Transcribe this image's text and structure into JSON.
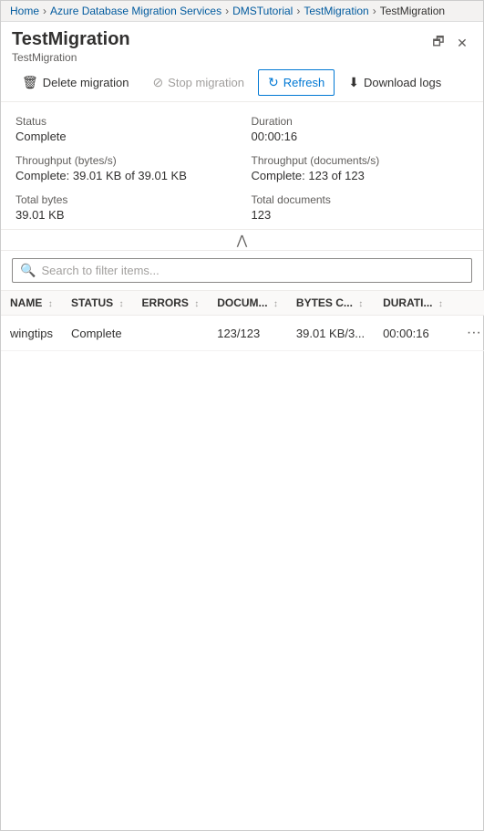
{
  "breadcrumb": {
    "items": [
      {
        "label": "Home",
        "active": true
      },
      {
        "label": "Azure Database Migration Services",
        "active": true
      },
      {
        "label": "DMSTutorial",
        "active": true
      },
      {
        "label": "TestMigration",
        "active": true
      },
      {
        "label": "TestMigration",
        "active": false
      }
    ],
    "separator": "›"
  },
  "header": {
    "title": "TestMigration",
    "subtitle": "TestMigration",
    "window_restore": "🗗",
    "window_close": "✕"
  },
  "toolbar": {
    "delete_label": "Delete migration",
    "stop_label": "Stop migration",
    "refresh_label": "Refresh",
    "download_label": "Download logs"
  },
  "stats": [
    {
      "label": "Status",
      "value": "Complete"
    },
    {
      "label": "Duration",
      "value": "00:00:16"
    },
    {
      "label": "Throughput (bytes/s)",
      "value": "Complete: 39.01 KB of 39.01 KB"
    },
    {
      "label": "Throughput (documents/s)",
      "value": "Complete: 123 of 123"
    },
    {
      "label": "Total bytes",
      "value": "39.01 KB"
    },
    {
      "label": "Total documents",
      "value": "123"
    }
  ],
  "search": {
    "placeholder": "Search to filter items..."
  },
  "table": {
    "columns": [
      {
        "label": "NAME",
        "key": "name"
      },
      {
        "label": "STATUS",
        "key": "status"
      },
      {
        "label": "ERRORS",
        "key": "errors"
      },
      {
        "label": "DOCUM...",
        "key": "documents"
      },
      {
        "label": "BYTES C...",
        "key": "bytes"
      },
      {
        "label": "DURATI...",
        "key": "duration"
      }
    ],
    "rows": [
      {
        "name": "wingtips",
        "status": "Complete",
        "errors": "",
        "documents": "123/123",
        "bytes": "39.01 KB/3...",
        "duration": "00:00:16"
      }
    ]
  }
}
